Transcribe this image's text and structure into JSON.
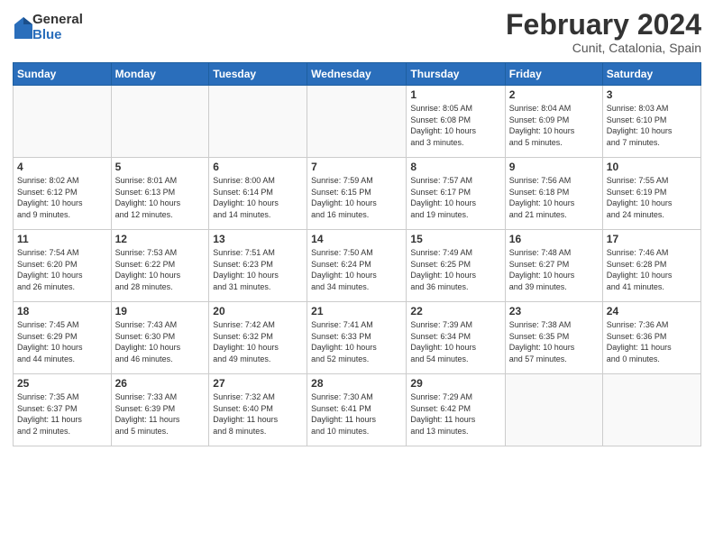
{
  "logo": {
    "general": "General",
    "blue": "Blue"
  },
  "title": {
    "month_year": "February 2024",
    "location": "Cunit, Catalonia, Spain"
  },
  "headers": [
    "Sunday",
    "Monday",
    "Tuesday",
    "Wednesday",
    "Thursday",
    "Friday",
    "Saturday"
  ],
  "weeks": [
    [
      {
        "day": "",
        "info": ""
      },
      {
        "day": "",
        "info": ""
      },
      {
        "day": "",
        "info": ""
      },
      {
        "day": "",
        "info": ""
      },
      {
        "day": "1",
        "info": "Sunrise: 8:05 AM\nSunset: 6:08 PM\nDaylight: 10 hours\nand 3 minutes."
      },
      {
        "day": "2",
        "info": "Sunrise: 8:04 AM\nSunset: 6:09 PM\nDaylight: 10 hours\nand 5 minutes."
      },
      {
        "day": "3",
        "info": "Sunrise: 8:03 AM\nSunset: 6:10 PM\nDaylight: 10 hours\nand 7 minutes."
      }
    ],
    [
      {
        "day": "4",
        "info": "Sunrise: 8:02 AM\nSunset: 6:12 PM\nDaylight: 10 hours\nand 9 minutes."
      },
      {
        "day": "5",
        "info": "Sunrise: 8:01 AM\nSunset: 6:13 PM\nDaylight: 10 hours\nand 12 minutes."
      },
      {
        "day": "6",
        "info": "Sunrise: 8:00 AM\nSunset: 6:14 PM\nDaylight: 10 hours\nand 14 minutes."
      },
      {
        "day": "7",
        "info": "Sunrise: 7:59 AM\nSunset: 6:15 PM\nDaylight: 10 hours\nand 16 minutes."
      },
      {
        "day": "8",
        "info": "Sunrise: 7:57 AM\nSunset: 6:17 PM\nDaylight: 10 hours\nand 19 minutes."
      },
      {
        "day": "9",
        "info": "Sunrise: 7:56 AM\nSunset: 6:18 PM\nDaylight: 10 hours\nand 21 minutes."
      },
      {
        "day": "10",
        "info": "Sunrise: 7:55 AM\nSunset: 6:19 PM\nDaylight: 10 hours\nand 24 minutes."
      }
    ],
    [
      {
        "day": "11",
        "info": "Sunrise: 7:54 AM\nSunset: 6:20 PM\nDaylight: 10 hours\nand 26 minutes."
      },
      {
        "day": "12",
        "info": "Sunrise: 7:53 AM\nSunset: 6:22 PM\nDaylight: 10 hours\nand 28 minutes."
      },
      {
        "day": "13",
        "info": "Sunrise: 7:51 AM\nSunset: 6:23 PM\nDaylight: 10 hours\nand 31 minutes."
      },
      {
        "day": "14",
        "info": "Sunrise: 7:50 AM\nSunset: 6:24 PM\nDaylight: 10 hours\nand 34 minutes."
      },
      {
        "day": "15",
        "info": "Sunrise: 7:49 AM\nSunset: 6:25 PM\nDaylight: 10 hours\nand 36 minutes."
      },
      {
        "day": "16",
        "info": "Sunrise: 7:48 AM\nSunset: 6:27 PM\nDaylight: 10 hours\nand 39 minutes."
      },
      {
        "day": "17",
        "info": "Sunrise: 7:46 AM\nSunset: 6:28 PM\nDaylight: 10 hours\nand 41 minutes."
      }
    ],
    [
      {
        "day": "18",
        "info": "Sunrise: 7:45 AM\nSunset: 6:29 PM\nDaylight: 10 hours\nand 44 minutes."
      },
      {
        "day": "19",
        "info": "Sunrise: 7:43 AM\nSunset: 6:30 PM\nDaylight: 10 hours\nand 46 minutes."
      },
      {
        "day": "20",
        "info": "Sunrise: 7:42 AM\nSunset: 6:32 PM\nDaylight: 10 hours\nand 49 minutes."
      },
      {
        "day": "21",
        "info": "Sunrise: 7:41 AM\nSunset: 6:33 PM\nDaylight: 10 hours\nand 52 minutes."
      },
      {
        "day": "22",
        "info": "Sunrise: 7:39 AM\nSunset: 6:34 PM\nDaylight: 10 hours\nand 54 minutes."
      },
      {
        "day": "23",
        "info": "Sunrise: 7:38 AM\nSunset: 6:35 PM\nDaylight: 10 hours\nand 57 minutes."
      },
      {
        "day": "24",
        "info": "Sunrise: 7:36 AM\nSunset: 6:36 PM\nDaylight: 11 hours\nand 0 minutes."
      }
    ],
    [
      {
        "day": "25",
        "info": "Sunrise: 7:35 AM\nSunset: 6:37 PM\nDaylight: 11 hours\nand 2 minutes."
      },
      {
        "day": "26",
        "info": "Sunrise: 7:33 AM\nSunset: 6:39 PM\nDaylight: 11 hours\nand 5 minutes."
      },
      {
        "day": "27",
        "info": "Sunrise: 7:32 AM\nSunset: 6:40 PM\nDaylight: 11 hours\nand 8 minutes."
      },
      {
        "day": "28",
        "info": "Sunrise: 7:30 AM\nSunset: 6:41 PM\nDaylight: 11 hours\nand 10 minutes."
      },
      {
        "day": "29",
        "info": "Sunrise: 7:29 AM\nSunset: 6:42 PM\nDaylight: 11 hours\nand 13 minutes."
      },
      {
        "day": "",
        "info": ""
      },
      {
        "day": "",
        "info": ""
      }
    ]
  ]
}
